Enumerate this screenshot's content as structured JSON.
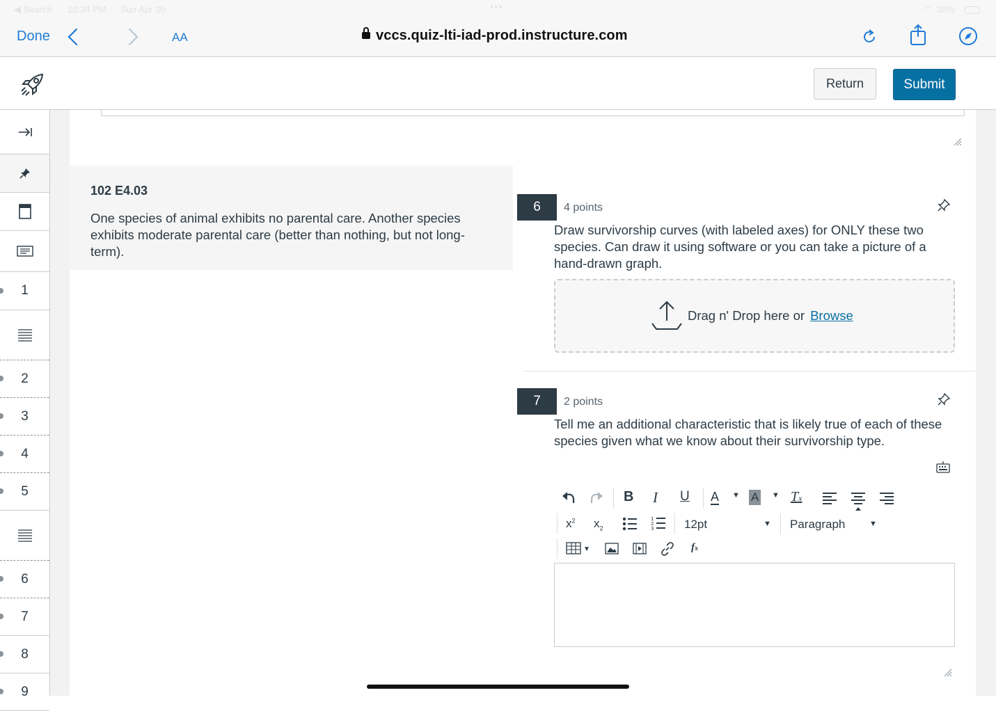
{
  "status_bar": {
    "back_label": "◀ Search",
    "time": "10:34 PM",
    "date": "Sun Apr 30",
    "battery": "38%"
  },
  "browser": {
    "done_label": "Done",
    "text_size_label": "AA",
    "url": "vccs.quiz-lti-iad-prod.instructure.com"
  },
  "header": {
    "return_label": "Return",
    "submit_label": "Submit"
  },
  "rail": {
    "numbers": [
      "1",
      "2",
      "3",
      "4",
      "5",
      "6",
      "7",
      "8",
      "9"
    ]
  },
  "stimulus": {
    "title": "102 E4.03",
    "text": "One species of animal exhibits no parental care. Another species exhibits moderate parental care (better than nothing, but not long-term)."
  },
  "questions": [
    {
      "number": "6",
      "points": "4 points",
      "text": "Draw survivorship curves (with labeled axes) for ONLY these two species. Can draw it using software or you can take a picture of a hand-drawn graph.",
      "upload_prompt": "Drag n' Drop here or",
      "upload_link": "Browse"
    },
    {
      "number": "7",
      "points": "2 points",
      "text": "Tell me an additional characteristic that is likely true of each of these species given what we know about their survivorship type.",
      "font_size": "12pt",
      "block_format": "Paragraph"
    }
  ]
}
